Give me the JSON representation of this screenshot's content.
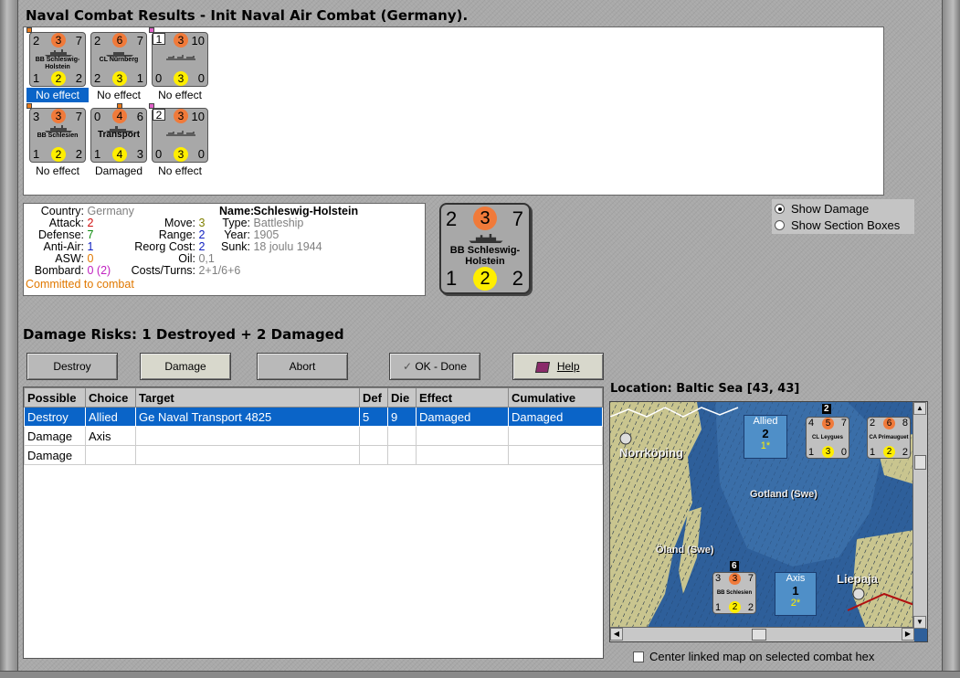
{
  "window": {
    "title": "Naval Combat Results - Init Naval Air Combat (Germany)."
  },
  "units": [
    {
      "name": "BB Schleswig-Holstein",
      "tl": "2",
      "top": "3",
      "tr": "7",
      "bl": "1",
      "bottom": "2",
      "br": "2",
      "result": "No effect",
      "selected": true,
      "flag": ""
    },
    {
      "name": "CL Nürnberg",
      "tl": "2",
      "top": "6",
      "tr": "7",
      "bl": "2",
      "bottom": "3",
      "br": "1",
      "result": "No effect",
      "selected": false,
      "flag": ""
    },
    {
      "name": "",
      "tl": "1",
      "top": "3",
      "tr": "10",
      "bl": "0",
      "bottom": "3",
      "br": "0",
      "result": "No effect",
      "selected": false,
      "flag": "1"
    },
    {
      "name": "BB Schlesien",
      "tl": "3",
      "top": "3",
      "tr": "7",
      "bl": "1",
      "bottom": "2",
      "br": "2",
      "result": "No effect",
      "selected": false,
      "flag": ""
    },
    {
      "name": "Transport",
      "tl": "0",
      "top": "4",
      "tr": "6",
      "bl": "1",
      "bottom": "4",
      "br": "3",
      "result": "Damaged",
      "selected": false,
      "flag": ""
    },
    {
      "name": "",
      "tl": "2",
      "top": "3",
      "tr": "10",
      "bl": "0",
      "bottom": "3",
      "br": "0",
      "result": "No effect",
      "selected": false,
      "flag": "2"
    }
  ],
  "info": {
    "country_label": "Country:",
    "country": "Germany",
    "attack_label": "Attack:",
    "attack": "2",
    "defense_label": "Defense:",
    "defense": "7",
    "antiair_label": "Anti-Air:",
    "antiair": "1",
    "asw_label": "ASW:",
    "asw": "0",
    "bombard_label": "Bombard:",
    "bombard": "0 (2)",
    "status": "Committed to combat",
    "move_label": "Move:",
    "move": "3",
    "range_label": "Range:",
    "range": "2",
    "reorg_label": "Reorg Cost:",
    "reorg": "2",
    "oil_label": "Oil:",
    "oil": "0,1",
    "costs_label": "Costs/Turns:",
    "costs": "2+1/6+6",
    "name_label": "Name:",
    "name": "Schleswig-Holstein",
    "type_label": "Type:",
    "type": "Battleship",
    "year_label": "Year:",
    "year": "1905",
    "sunk_label": "Sunk:",
    "sunk": "18 joulu 1944"
  },
  "big_counter": {
    "tl": "2",
    "top": "3",
    "tr": "7",
    "name": "BB Schleswig-Holstein",
    "bl": "1",
    "bottom": "2",
    "br": "2"
  },
  "display_options": {
    "show_damage": "Show Damage",
    "show_section_boxes": "Show Section Boxes",
    "selected": "show_damage"
  },
  "damage_risks": "Damage Risks: 1 Destroyed + 2 Damaged",
  "buttons": {
    "destroy": "Destroy",
    "damage": "Damage",
    "abort": "Abort",
    "ok_done": "OK - Done",
    "help": "Help"
  },
  "table": {
    "headers": [
      "Possible",
      "Choice",
      "Target",
      "Def",
      "Die",
      "Effect",
      "Cumulative"
    ],
    "rows": [
      [
        "Destroy",
        "Allied",
        "Ge Naval Transport 4825",
        "5",
        "9",
        "Damaged",
        "Damaged"
      ],
      [
        "Damage",
        "Axis",
        "",
        "",
        "",
        "",
        ""
      ],
      [
        "Damage",
        "",
        "",
        "",
        "",
        "",
        ""
      ]
    ]
  },
  "location": "Location:  Baltic Sea [43, 43]",
  "map": {
    "labels": {
      "norrkoping": "Norrköping",
      "gotland": "Gotland (Swe)",
      "oland": "Öland (Swe)",
      "liepaja": "Liepaja"
    },
    "allied_box": {
      "title": "Allied",
      "count": "2",
      "sub": "1*"
    },
    "axis_box": {
      "title": "Axis",
      "count": "1",
      "sub": "2*"
    },
    "stack_counts": {
      "top": "2",
      "bottom": "6"
    },
    "counters": [
      {
        "name": "CL Leygues",
        "tl": "4",
        "top": "5",
        "tr": "7",
        "bl": "1",
        "bottom": "3",
        "br": "0"
      },
      {
        "name": "CA Primauguet",
        "tl": "2",
        "top": "6",
        "tr": "8",
        "bl": "1",
        "bottom": "2",
        "br": "2"
      },
      {
        "name": "BB Schlesien",
        "tl": "3",
        "top": "3",
        "tr": "7",
        "bl": "1",
        "bottom": "2",
        "br": "2"
      }
    ]
  },
  "center_linked_map": "Center linked map on selected combat hex",
  "colors": {
    "selection": "#0a64c8",
    "sea": "#2e5f9a",
    "land": "#c8c890",
    "orange_circle": "#f07a3a",
    "yellow_circle": "#ffee00"
  }
}
